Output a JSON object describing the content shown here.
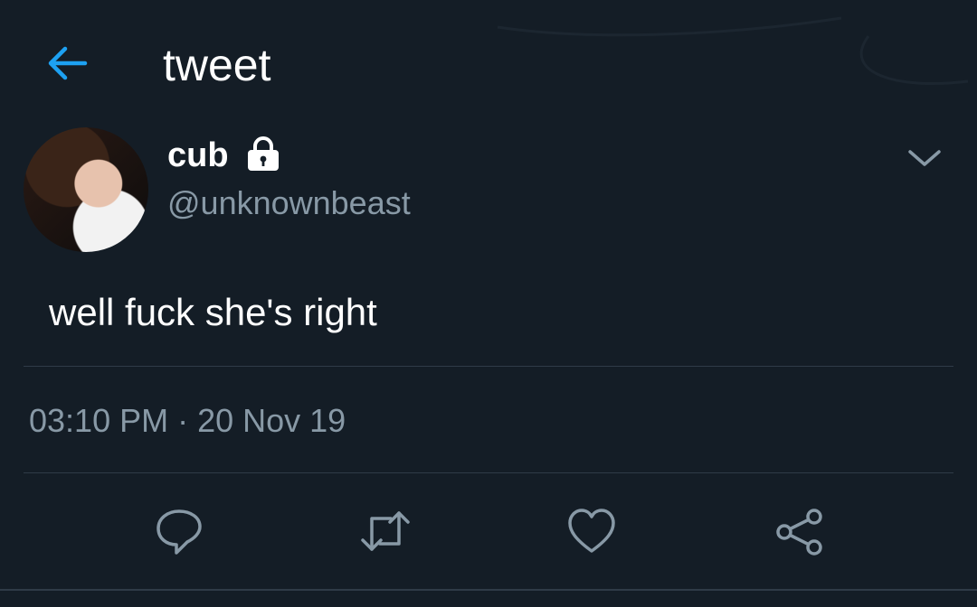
{
  "header": {
    "title": "tweet",
    "back_icon": "arrow-left-icon",
    "accent_color": "#1da1f2"
  },
  "tweet": {
    "author": {
      "name": "cub",
      "handle": "@unknownbeast",
      "protected_icon": "lock-icon"
    },
    "text": "well fuck she's right",
    "timestamp": "03:10 PM · 20 Nov 19",
    "menu_icon": "chevron-down-icon"
  },
  "actions": [
    {
      "icon": "reply-icon"
    },
    {
      "icon": "retweet-icon"
    },
    {
      "icon": "like-icon"
    },
    {
      "icon": "share-icon"
    }
  ],
  "colors": {
    "background": "#141d26",
    "secondary_text": "#8899a6",
    "divider": "#2f3b47"
  }
}
